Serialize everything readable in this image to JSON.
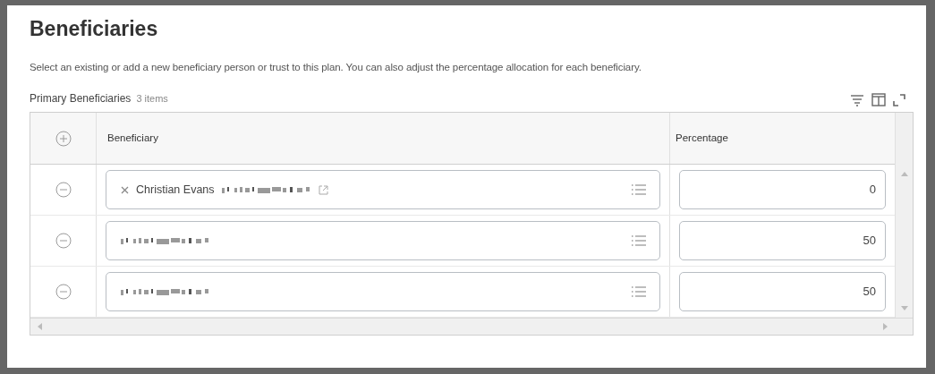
{
  "title": "Beneficiaries",
  "description": "Select an existing or add a new beneficiary person or trust to this plan. You can also adjust the percentage allocation for each beneficiary.",
  "grid": {
    "title": "Primary Beneficiaries",
    "count": "3 items",
    "columns": [
      "Beneficiary",
      "Percentage"
    ],
    "rows": [
      {
        "beneficiary": "Christian Evans",
        "redacted": true,
        "removable": true,
        "linked": true,
        "percentage": "0"
      },
      {
        "redacted": true,
        "removable": false,
        "linked": false,
        "percentage": "50"
      },
      {
        "redacted": true,
        "removable": false,
        "linked": false,
        "percentage": "50"
      }
    ]
  }
}
